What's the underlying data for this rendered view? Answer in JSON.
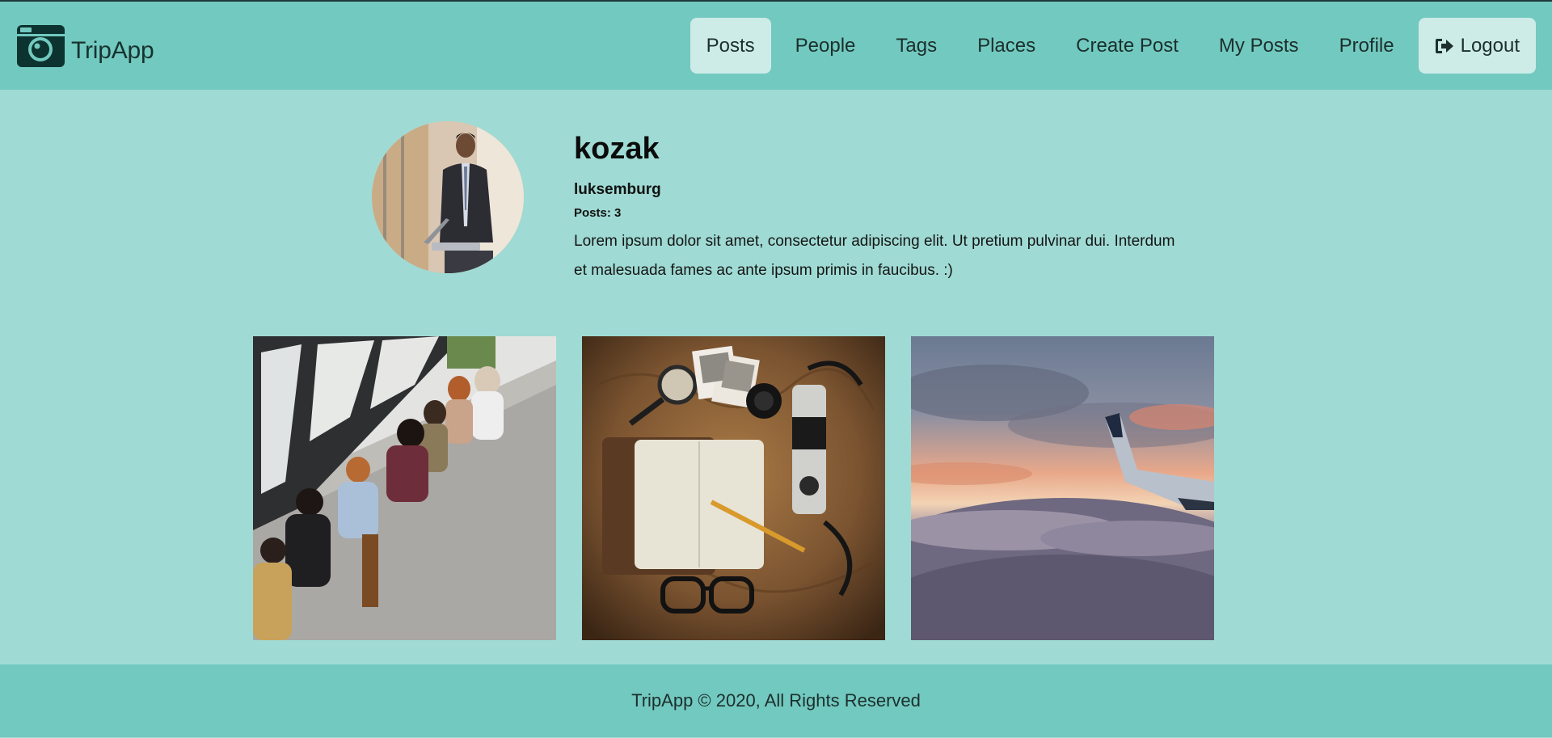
{
  "brand": {
    "name": "TripApp",
    "icon": "camera-icon"
  },
  "nav": {
    "items": [
      {
        "label": "Posts",
        "active": true
      },
      {
        "label": "People"
      },
      {
        "label": "Tags"
      },
      {
        "label": "Places"
      },
      {
        "label": "Create Post"
      },
      {
        "label": "My Posts"
      },
      {
        "label": "Profile"
      }
    ],
    "logout": {
      "label": "Logout",
      "icon": "logout-icon"
    }
  },
  "profile": {
    "username": "kozak",
    "place": "luksemburg",
    "posts_label": "Posts: 3",
    "bio": "Lorem ipsum dolor sit amet, consectetur adipiscing elit. Ut pretium pulvinar dui. Interdum et malesuada fames ac ante ipsum primis in faucibus. :)"
  },
  "gallery": {
    "photos": [
      {
        "subject": "people-with-phones"
      },
      {
        "subject": "travel-flatlay"
      },
      {
        "subject": "airplane-wing-sunset"
      }
    ]
  },
  "footer": {
    "text": "TripApp © 2020, All Rights Reserved"
  },
  "colors": {
    "page_bg": "#9fdbd4",
    "header_bg": "#72c9bf",
    "pill_bg": "#cdebe7",
    "text_dark": "#1c2f2d"
  }
}
